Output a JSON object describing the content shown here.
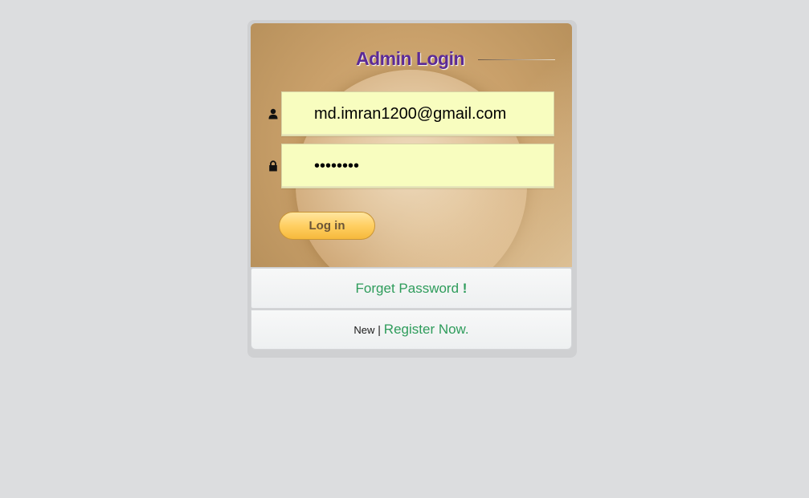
{
  "login": {
    "title": "Admin Login",
    "email_value": "md.imran1200@gmail.com",
    "password_value": "12345678",
    "submit_label": "Log in"
  },
  "icons": {
    "user": "user-icon",
    "password": "lock-icon"
  },
  "links": {
    "forget_password": "Forget Password",
    "forget_password_suffix": "!",
    "new_label": "New",
    "separator": "|",
    "register": "Register Now."
  },
  "colors": {
    "title": "#5b2a96",
    "link": "#2e9c5b",
    "input_bg": "#f8fdbf",
    "button": "#ffcf62"
  }
}
